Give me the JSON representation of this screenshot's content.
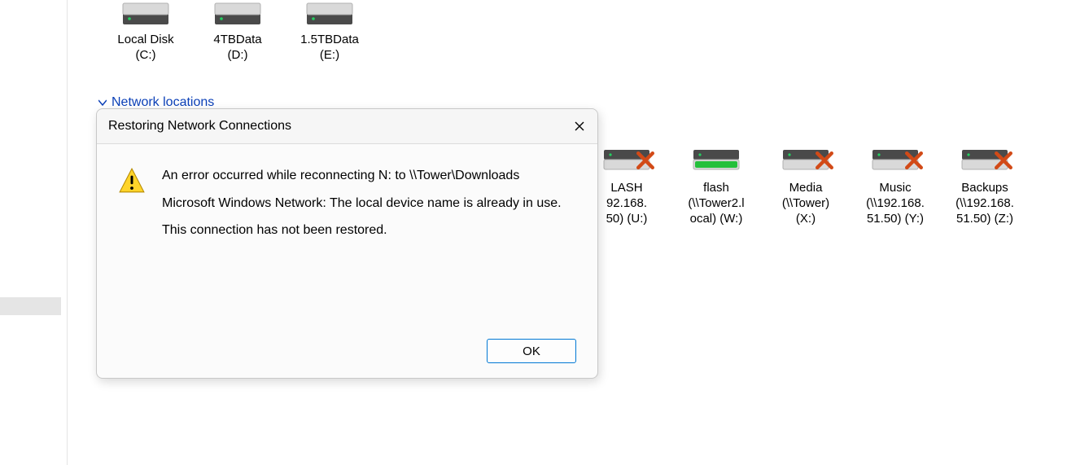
{
  "localDrives": [
    {
      "label1": "Local Disk",
      "label2": "(C:)"
    },
    {
      "label1": "4TBData",
      "label2": "(D:)"
    },
    {
      "label1": "1.5TBData",
      "label2": "(E:)"
    }
  ],
  "sectionHeader": "Network locations",
  "netDrives": [
    {
      "label1": "LASH",
      "label2": "92.168.",
      "label3": "50) (U:)",
      "disconnected": true,
      "fill": "dark"
    },
    {
      "label1": "flash",
      "label2": "(\\\\Tower2.l",
      "label3": "ocal) (W:)",
      "disconnected": false,
      "fill": "green"
    },
    {
      "label1": "Media",
      "label2": "(\\\\Tower)",
      "label3": "(X:)",
      "disconnected": true,
      "fill": "dark"
    },
    {
      "label1": "Music",
      "label2": "(\\\\192.168.",
      "label3": "51.50) (Y:)",
      "disconnected": true,
      "fill": "dark"
    },
    {
      "label1": "Backups",
      "label2": "(\\\\192.168.",
      "label3": "51.50) (Z:)",
      "disconnected": true,
      "fill": "dark"
    }
  ],
  "dialog": {
    "title": "Restoring Network Connections",
    "line1": "An error occurred while reconnecting N: to \\\\Tower\\Downloads",
    "line2": "Microsoft Windows Network: The local device name is already in use.",
    "line3": "This connection has not been restored.",
    "ok": "OK"
  }
}
